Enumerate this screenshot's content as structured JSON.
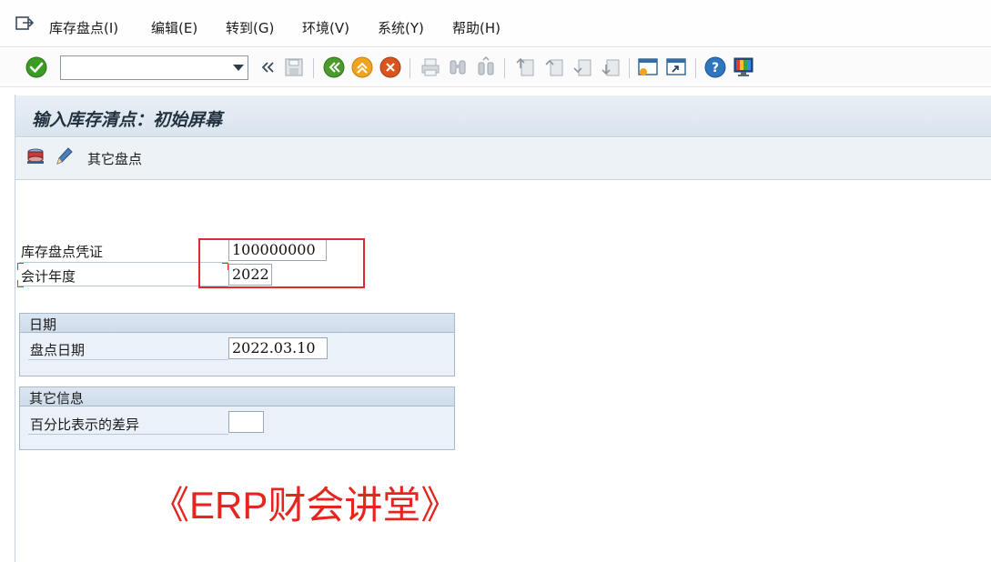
{
  "menu": {
    "items": [
      "库存盘点(I)",
      "编辑(E)",
      "转到(G)",
      "环境(V)",
      "系统(Y)",
      "帮助(H)"
    ]
  },
  "toolbar": {
    "command_value": "",
    "icons": [
      "enter-icon",
      "command-dropdown-icon",
      "collapse-icon",
      "save-icon",
      "back-icon",
      "exit-icon",
      "cancel-icon",
      "print-icon",
      "find-icon",
      "find-next-icon",
      "first-page-icon",
      "previous-page-icon",
      "next-page-icon",
      "last-page-icon",
      "create-session-icon",
      "shortcut-icon",
      "help-icon",
      "customize-layout-icon"
    ]
  },
  "screen": {
    "title": "输入库存清点：初始屏幕"
  },
  "app_toolbar": {
    "other_counts_label": "其它盘点"
  },
  "form": {
    "doc_label": "库存盘点凭证",
    "doc_value": "100000000",
    "year_label": "会计年度",
    "year_value": "2022"
  },
  "date_group": {
    "title": "日期",
    "count_date_label": "盘点日期",
    "count_date_value": "2022.03.10"
  },
  "other_group": {
    "title": "其它信息",
    "percent_diff_label": "百分比表示的差异",
    "percent_diff_value": ""
  },
  "watermark": "《ERP财会讲堂》",
  "colors": {
    "accent_green": "#3a9d23",
    "highlight_red": "#e02b2b",
    "watermark_red": "#e3261f"
  }
}
